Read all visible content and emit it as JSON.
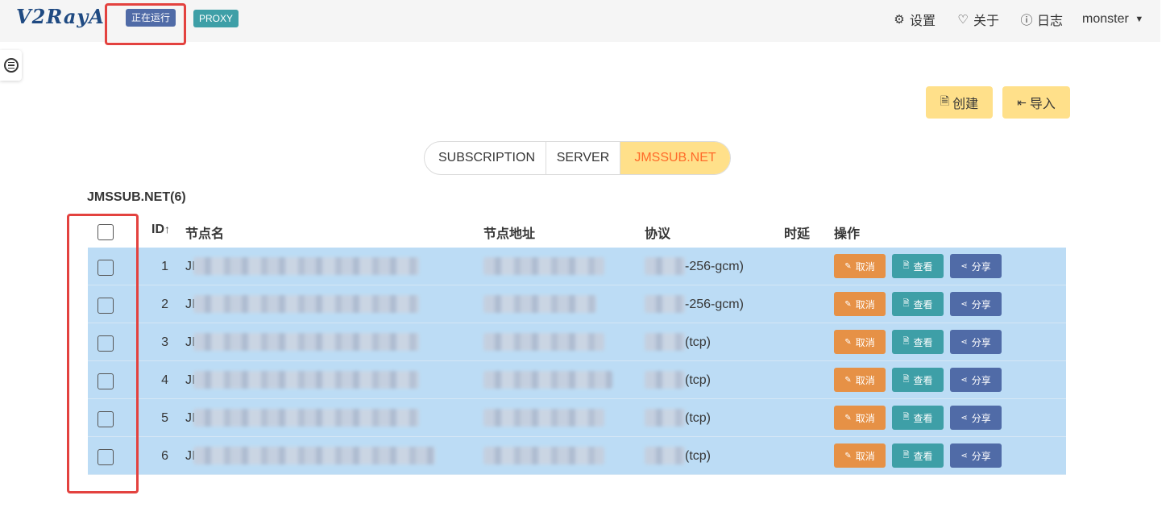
{
  "header": {
    "logo": "V2RayA",
    "status_badge": "正在运行",
    "mode_badge": "PROXY",
    "nav": {
      "settings": "设置",
      "about": "关于",
      "log": "日志",
      "user": "monster"
    }
  },
  "toolbar": {
    "create_label": "创建",
    "import_label": "导入"
  },
  "tabs": [
    {
      "label": "SUBSCRIPTION",
      "active": false
    },
    {
      "label": "SERVER",
      "active": false
    },
    {
      "label": "JMSSUB.NET",
      "active": true
    }
  ],
  "group": {
    "title": "JMSSUB.NET(6)"
  },
  "table": {
    "headers": {
      "id": "ID",
      "id_sort_icon": "↑",
      "name": "节点名",
      "address": "节点地址",
      "protocol": "协议",
      "delay": "时延",
      "actions": "操作"
    },
    "rows": [
      {
        "id": "1",
        "name_prefix": "JI",
        "protocol_suffix": "-256-gcm)"
      },
      {
        "id": "2",
        "name_prefix": "JI",
        "protocol_suffix": "-256-gcm)"
      },
      {
        "id": "3",
        "name_prefix": "JI",
        "protocol_suffix": "(tcp)"
      },
      {
        "id": "4",
        "name_prefix": "JI",
        "protocol_suffix": "(tcp)"
      },
      {
        "id": "5",
        "name_prefix": "JI",
        "protocol_suffix": "(tcp)"
      },
      {
        "id": "6",
        "name_prefix": "JI",
        "protocol_suffix": "(tcp)"
      }
    ],
    "actions": {
      "cancel": "取消",
      "view": "查看",
      "share": "分享"
    }
  },
  "icons": {
    "settings": "gear-icon",
    "about": "heart-icon",
    "log": "info-icon",
    "user": "caret-down-icon",
    "create": "document-icon",
    "import": "import-icon",
    "cancel": "cancel-icon",
    "view": "view-icon",
    "share": "share-icon"
  },
  "colors": {
    "navbar_bg": "#f5f5f5",
    "status_badge": "#506ba7",
    "mode_badge": "#3e9fa7",
    "warning_button": "#ffe08a",
    "active_tab_text": "#ff6b2a",
    "row_selected": "#bcdcf5",
    "cancel_button": "#e69146",
    "view_button": "#3e9fa7",
    "share_button": "#506ba7",
    "annotation_box": "#e3423f"
  }
}
